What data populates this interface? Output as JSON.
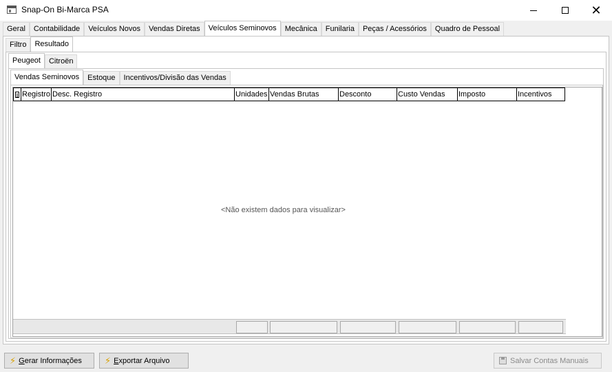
{
  "window": {
    "title": "Snap-On Bi-Marca PSA",
    "minimize": "—",
    "maximize": "☐",
    "close": "✕"
  },
  "main_tabs": [
    "Geral",
    "Contabilidade",
    "Veículos Novos",
    "Vendas Diretas",
    "Veículos Seminovos",
    "Mecânica",
    "Funilaria",
    "Peças / Acessórios",
    "Quadro de Pessoal"
  ],
  "main_tab_active": "Veículos Seminovos",
  "sub_tabs": [
    "Filtro",
    "Resultado"
  ],
  "brand_tabs": [
    "Peugeot",
    "Citroën"
  ],
  "report_tabs": [
    "Vendas Seminovos",
    "Estoque",
    "Incentivos/Divisão das Vendas"
  ],
  "grid": {
    "columns": [
      "Registro",
      "Desc. Registro",
      "Unidades",
      "Vendas Brutas",
      "Desconto",
      "Custo Vendas",
      "Imposto",
      "Incentivos"
    ],
    "empty_message": "<Não existem dados para visualizar>"
  },
  "buttons": {
    "gerar_prefix": "G",
    "gerar_rest": "erar Informações",
    "exportar_prefix": "E",
    "exportar_rest": "xportar Arquivo",
    "salvar": "Salvar Contas Manuais"
  },
  "icons": {
    "bolt": "⚡"
  }
}
